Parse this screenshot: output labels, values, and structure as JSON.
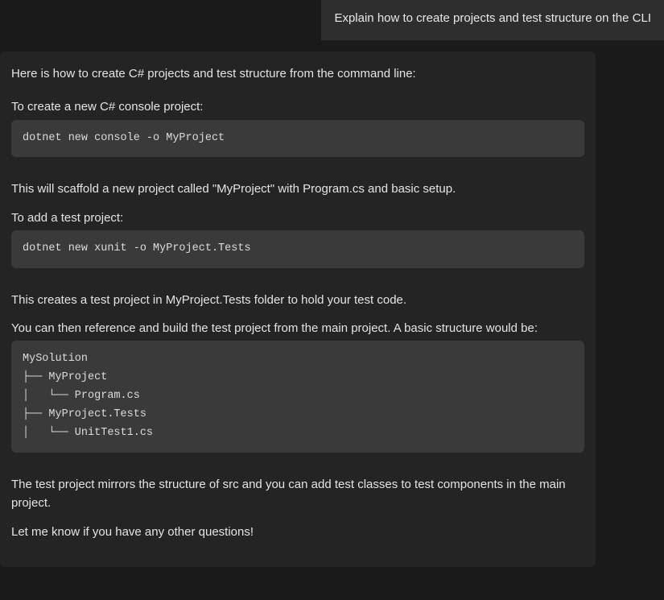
{
  "header": {
    "user_prompt": "Explain how to create projects and test structure on the CLI"
  },
  "response": {
    "intro": "Here is how to create C# projects and test structure from the command line:",
    "create_project_label": "To create a new C# console project:",
    "code_console": "dotnet new console -o MyProject",
    "scaffold_note": "This will scaffold a new project called \"MyProject\" with Program.cs and basic setup.",
    "add_test_label": "To add a test project:",
    "code_xunit": "dotnet new xunit -o MyProject.Tests",
    "test_folder_note": "This creates a test project in MyProject.Tests folder to hold your test code.",
    "structure_intro": "You can then reference and build the test project from the main project. A basic structure would be:",
    "code_tree": "MySolution\n├── MyProject\n│   └── Program.cs\n├── MyProject.Tests\n│   └── UnitTest1.cs",
    "mirror_note": "The test project mirrors the structure of src and you can add test classes to test components in the main project.",
    "closing": "Let me know if you have any other questions!"
  }
}
